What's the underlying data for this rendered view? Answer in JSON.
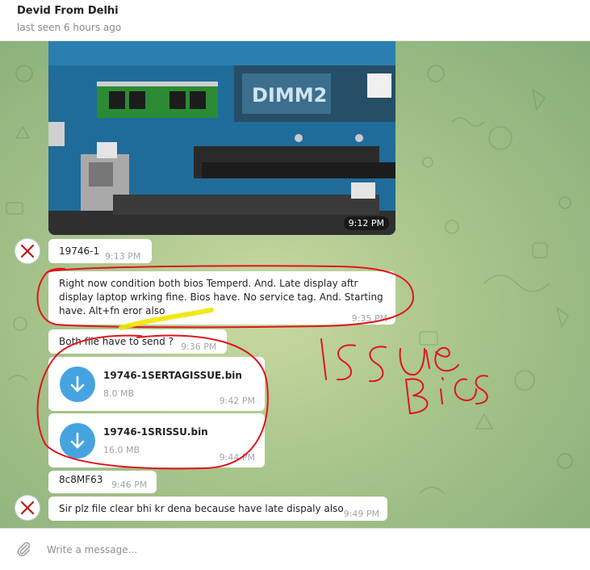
{
  "header": {
    "name": "Devid From Delhi",
    "status": "last seen 6 hours ago"
  },
  "photo_message": {
    "time": "9:12 PM"
  },
  "messages": [
    {
      "text": "19746-1",
      "time": "9:13 PM"
    },
    {
      "text": "Right now condition both bios Temperd.   And. Late display aftr display laptop wrking fine.  Bios have.  No service tag. And. Starting have. Alt+fn eror also",
      "time": "9:35 PM"
    },
    {
      "text": "Both file have to send ?",
      "time": "9:36 PM"
    },
    {
      "text": "8c8MF63",
      "time": "9:46 PM"
    },
    {
      "text": "Sir plz file clear bhi kr dena because have late dispaly also",
      "time": "9:49 PM"
    }
  ],
  "files": [
    {
      "name": "19746-1SERTAGISSUE.bin",
      "size": "8.0 MB",
      "time": "9:42 PM",
      "icon": "download-icon"
    },
    {
      "name": "19746-1SRISSU.bin",
      "size": "16.0 MB",
      "time": "9:44 PM",
      "icon": "download-icon"
    }
  ],
  "composer": {
    "placeholder": "Write a message...",
    "icon": "paperclip-icon"
  },
  "colors": {
    "accent": "#45a4e0",
    "annotation": "#e0141e",
    "highlight": "#f2e600"
  }
}
